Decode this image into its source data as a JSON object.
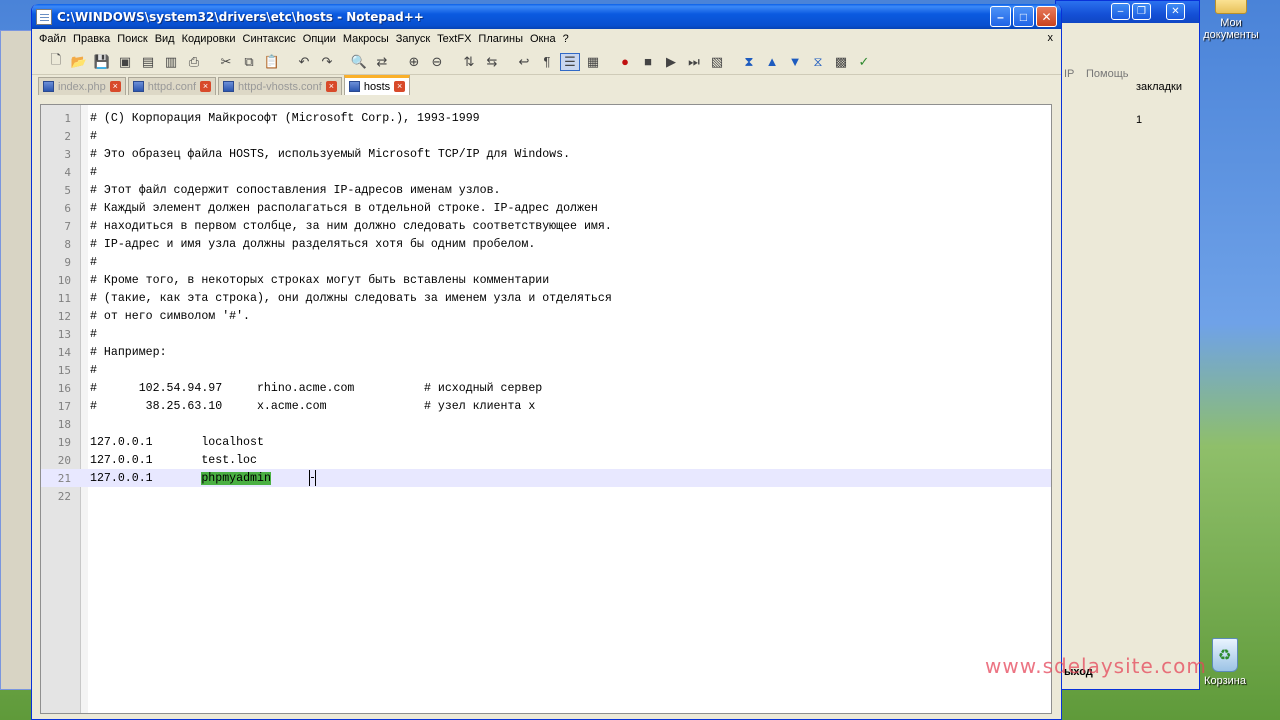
{
  "window": {
    "title": "C:\\WINDOWS\\system32\\drivers\\etc\\hosts - Notepad++",
    "minimize_glyph": "–",
    "maximize_glyph": "□",
    "close_glyph": "✕"
  },
  "menu": [
    {
      "id": "file",
      "label": "Файл"
    },
    {
      "id": "edit",
      "label": "Правка"
    },
    {
      "id": "search",
      "label": "Поиск"
    },
    {
      "id": "view",
      "label": "Вид"
    },
    {
      "id": "encoding",
      "label": "Кодировки"
    },
    {
      "id": "syntax",
      "label": "Синтаксис"
    },
    {
      "id": "options",
      "label": "Опции"
    },
    {
      "id": "macros",
      "label": "Макросы"
    },
    {
      "id": "run",
      "label": "Запуск"
    },
    {
      "id": "textfx",
      "label": "TextFX"
    },
    {
      "id": "plugins",
      "label": "Плагины"
    },
    {
      "id": "windows",
      "label": "Окна"
    },
    {
      "id": "help",
      "label": "?"
    }
  ],
  "menu_close": "x",
  "toolbar": [
    {
      "id": "new",
      "icon": "new-file-icon",
      "glyph": "🗋"
    },
    {
      "id": "open",
      "icon": "open-folder-icon",
      "glyph": "📂"
    },
    {
      "id": "save",
      "icon": "save-icon",
      "glyph": "💾"
    },
    {
      "id": "save-all",
      "icon": "save-all-icon",
      "glyph": "▣"
    },
    {
      "id": "close",
      "icon": "close-file-icon",
      "glyph": "▤"
    },
    {
      "id": "close-all",
      "icon": "close-all-icon",
      "glyph": "▥"
    },
    {
      "id": "print",
      "icon": "print-icon",
      "glyph": "⎙"
    },
    {
      "id": "sep1",
      "icon": "separator",
      "glyph": ""
    },
    {
      "id": "cut",
      "icon": "cut-icon",
      "glyph": "✂"
    },
    {
      "id": "copy",
      "icon": "copy-icon",
      "glyph": "⧉"
    },
    {
      "id": "paste",
      "icon": "paste-icon",
      "glyph": "📋"
    },
    {
      "id": "sep2",
      "icon": "separator",
      "glyph": ""
    },
    {
      "id": "undo",
      "icon": "undo-icon",
      "glyph": "↶"
    },
    {
      "id": "redo",
      "icon": "redo-icon",
      "glyph": "↷"
    },
    {
      "id": "sep3",
      "icon": "separator",
      "glyph": ""
    },
    {
      "id": "find",
      "icon": "find-icon",
      "glyph": "🔍"
    },
    {
      "id": "replace",
      "icon": "replace-icon",
      "glyph": "⇄"
    },
    {
      "id": "sep4",
      "icon": "separator",
      "glyph": ""
    },
    {
      "id": "zoom-in",
      "icon": "zoom-in-icon",
      "glyph": "⊕"
    },
    {
      "id": "zoom-out",
      "icon": "zoom-out-icon",
      "glyph": "⊖"
    },
    {
      "id": "sep5",
      "icon": "separator",
      "glyph": ""
    },
    {
      "id": "sync-v",
      "icon": "sync-vertical-icon",
      "glyph": "⇅"
    },
    {
      "id": "sync-h",
      "icon": "sync-horizontal-icon",
      "glyph": "⇆"
    },
    {
      "id": "sep6",
      "icon": "separator",
      "glyph": ""
    },
    {
      "id": "wrap",
      "icon": "word-wrap-icon",
      "glyph": "↩"
    },
    {
      "id": "all-chars",
      "icon": "show-all-chars-icon",
      "glyph": "¶"
    },
    {
      "id": "indent-guide",
      "icon": "indent-guide-icon",
      "glyph": "☰",
      "pressed": true
    },
    {
      "id": "udl",
      "icon": "user-language-icon",
      "glyph": "▦"
    },
    {
      "id": "sep7",
      "icon": "separator",
      "glyph": ""
    },
    {
      "id": "rec",
      "icon": "record-macro-icon",
      "glyph": "●",
      "tone": "red"
    },
    {
      "id": "stop",
      "icon": "stop-macro-icon",
      "glyph": "■"
    },
    {
      "id": "play",
      "icon": "play-macro-icon",
      "glyph": "▶"
    },
    {
      "id": "play-multi",
      "icon": "play-multiple-icon",
      "glyph": "⏭"
    },
    {
      "id": "save-macro",
      "icon": "save-macro-icon",
      "glyph": "▧"
    },
    {
      "id": "sep8",
      "icon": "separator",
      "glyph": ""
    },
    {
      "id": "tfx1",
      "icon": "textfx-sort-icon",
      "glyph": "⧗",
      "tone": "blue"
    },
    {
      "id": "tfx2",
      "icon": "textfx-up-icon",
      "glyph": "▲",
      "tone": "blue"
    },
    {
      "id": "tfx3",
      "icon": "textfx-down-icon",
      "glyph": "▼",
      "tone": "blue"
    },
    {
      "id": "tfx4",
      "icon": "textfx-merge-icon",
      "glyph": "⧖",
      "tone": "blue"
    },
    {
      "id": "tfx5",
      "icon": "textfx-tool-icon",
      "glyph": "▩"
    },
    {
      "id": "spell",
      "icon": "spellcheck-icon",
      "glyph": "✓",
      "tone": "green"
    }
  ],
  "tabs": [
    {
      "label": "index.php",
      "active": false
    },
    {
      "label": "httpd.conf",
      "active": false
    },
    {
      "label": "httpd-vhosts.conf",
      "active": false
    },
    {
      "label": "hosts",
      "active": true
    }
  ],
  "editor": {
    "lines": [
      {
        "n": "1",
        "text": "# (C) Корпорация Майкрософт (Microsoft Corp.), 1993-1999"
      },
      {
        "n": "2",
        "text": "#"
      },
      {
        "n": "3",
        "text": "# Это образец файла HOSTS, используемый Microsoft TCP/IP для Windows."
      },
      {
        "n": "4",
        "text": "#"
      },
      {
        "n": "5",
        "text": "# Этот файл содержит сопоставления IP-адресов именам узлов."
      },
      {
        "n": "6",
        "text": "# Каждый элемент должен располагаться в отдельной строке. IP-адрес должен"
      },
      {
        "n": "7",
        "text": "# находиться в первом столбце, за ним должно следовать соответствующее имя."
      },
      {
        "n": "8",
        "text": "# IP-адрес и имя узла должны разделяться хотя бы одним пробелом."
      },
      {
        "n": "9",
        "text": "#"
      },
      {
        "n": "10",
        "text": "# Кроме того, в некоторых строках могут быть вставлены комментарии"
      },
      {
        "n": "11",
        "text": "# (такие, как эта строка), они должны следовать за именем узла и отделяться"
      },
      {
        "n": "12",
        "text": "# от него символом '#'."
      },
      {
        "n": "13",
        "text": "#"
      },
      {
        "n": "14",
        "text": "# Например:"
      },
      {
        "n": "15",
        "text": "#"
      },
      {
        "n": "16",
        "text": "#      102.54.94.97     rhino.acme.com          # исходный сервер"
      },
      {
        "n": "17",
        "text": "#       38.25.63.10     x.acme.com              # узел клиента x"
      },
      {
        "n": "18",
        "text": ""
      },
      {
        "n": "19",
        "text": "127.0.0.1       localhost"
      },
      {
        "n": "20",
        "text": "127.0.0.1       test.loc"
      },
      {
        "n": "21",
        "text": "127.0.0.1       ",
        "selected": "phpmyadmin",
        "current": true
      },
      {
        "n": "22",
        "text": ""
      }
    ]
  },
  "background_window": {
    "menu_partial_1": "IP",
    "menu_partial_2": "Помощь",
    "bookmarks_partial": "закладки",
    "tab_partial": "1",
    "exit_partial": "ыход"
  },
  "desktop": {
    "my_documents": "Мои документы",
    "recycle_bin": "Корзина"
  },
  "watermark": "www.sdelaysite.com"
}
